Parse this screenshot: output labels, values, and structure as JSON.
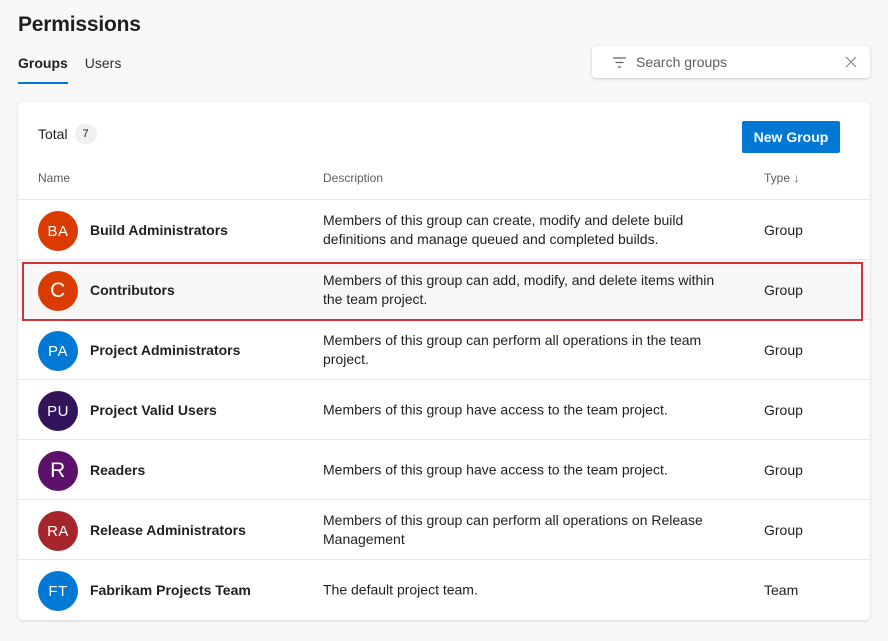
{
  "page": {
    "title": "Permissions"
  },
  "tabs": [
    {
      "label": "Groups",
      "active": true
    },
    {
      "label": "Users",
      "active": false
    }
  ],
  "search": {
    "placeholder": "Search groups",
    "value": "",
    "filter_icon": "filter-icon",
    "clear_icon": "close-icon"
  },
  "card": {
    "total_label": "Total",
    "total_count": "7",
    "new_group_label": "New Group",
    "columns": {
      "name": "Name",
      "description": "Description",
      "type": "Type ↓"
    }
  },
  "groups": [
    {
      "initials": "BA",
      "color": "#da3b01",
      "name": "Build Administrators",
      "description": "Members of this group can create, modify and delete build definitions and manage queued and completed builds.",
      "type": "Group"
    },
    {
      "initials": "C",
      "color": "#da3b01",
      "name": "Contributors",
      "description": "Members of this group can add, modify, and delete items within the team project.",
      "type": "Group",
      "highlighted": true
    },
    {
      "initials": "PA",
      "color": "#0078d4",
      "name": "Project Administrators",
      "description": "Members of this group can perform all operations in the team project.",
      "type": "Group"
    },
    {
      "initials": "PU",
      "color": "#32145a",
      "name": "Project Valid Users",
      "description": "Members of this group have access to the team project.",
      "type": "Group"
    },
    {
      "initials": "R",
      "color": "#5c126b",
      "name": "Readers",
      "description": "Members of this group have access to the team project.",
      "type": "Group"
    },
    {
      "initials": "RA",
      "color": "#a4262c",
      "name": "Release Administrators",
      "description": "Members of this group can perform all operations on Release Management",
      "type": "Group"
    },
    {
      "initials": "FT",
      "color": "#0078d4",
      "name": "Fabrikam Projects Team",
      "description": "The default project team.",
      "type": "Team"
    }
  ],
  "colors": {
    "accent": "#0078d4",
    "highlight_border": "#d13438"
  }
}
